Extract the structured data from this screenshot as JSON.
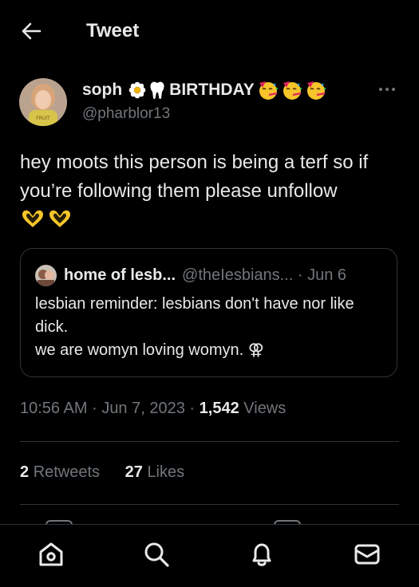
{
  "header": {
    "title": "Tweet",
    "back_icon": "arrow-left-icon"
  },
  "author": {
    "name_prefix": "soph",
    "name_word": "BIRTHDAY",
    "handle": "@pharblor13",
    "avatar_icon": "user-avatar"
  },
  "tweet": {
    "text": "hey moots this person is being a terf so if you’re following them please unfollow"
  },
  "quote": {
    "name": "home of lesb...",
    "handle": "@theIesbians...",
    "separator": "·",
    "date": "Jun 6",
    "text": "lesbian reminder: lesbians don't have nor like dick.\nwe are womyn loving womyn. ⚢"
  },
  "meta": {
    "time": "10:56 AM",
    "separator": "·",
    "date": "Jun 7, 2023",
    "views_count": "1,542",
    "views_label": "Views"
  },
  "stats": {
    "retweets_count": "2",
    "retweets_label": "Retweets",
    "likes_count": "27",
    "likes_label": "Likes"
  },
  "nav": {
    "items": [
      "home-icon",
      "search-icon",
      "notifications-icon",
      "messages-icon"
    ]
  },
  "colors": {
    "background": "#000000",
    "text": "#e7e9ea",
    "muted": "#71767b",
    "divider": "#2f3336",
    "emoji_yellow": "#f5c52b"
  }
}
